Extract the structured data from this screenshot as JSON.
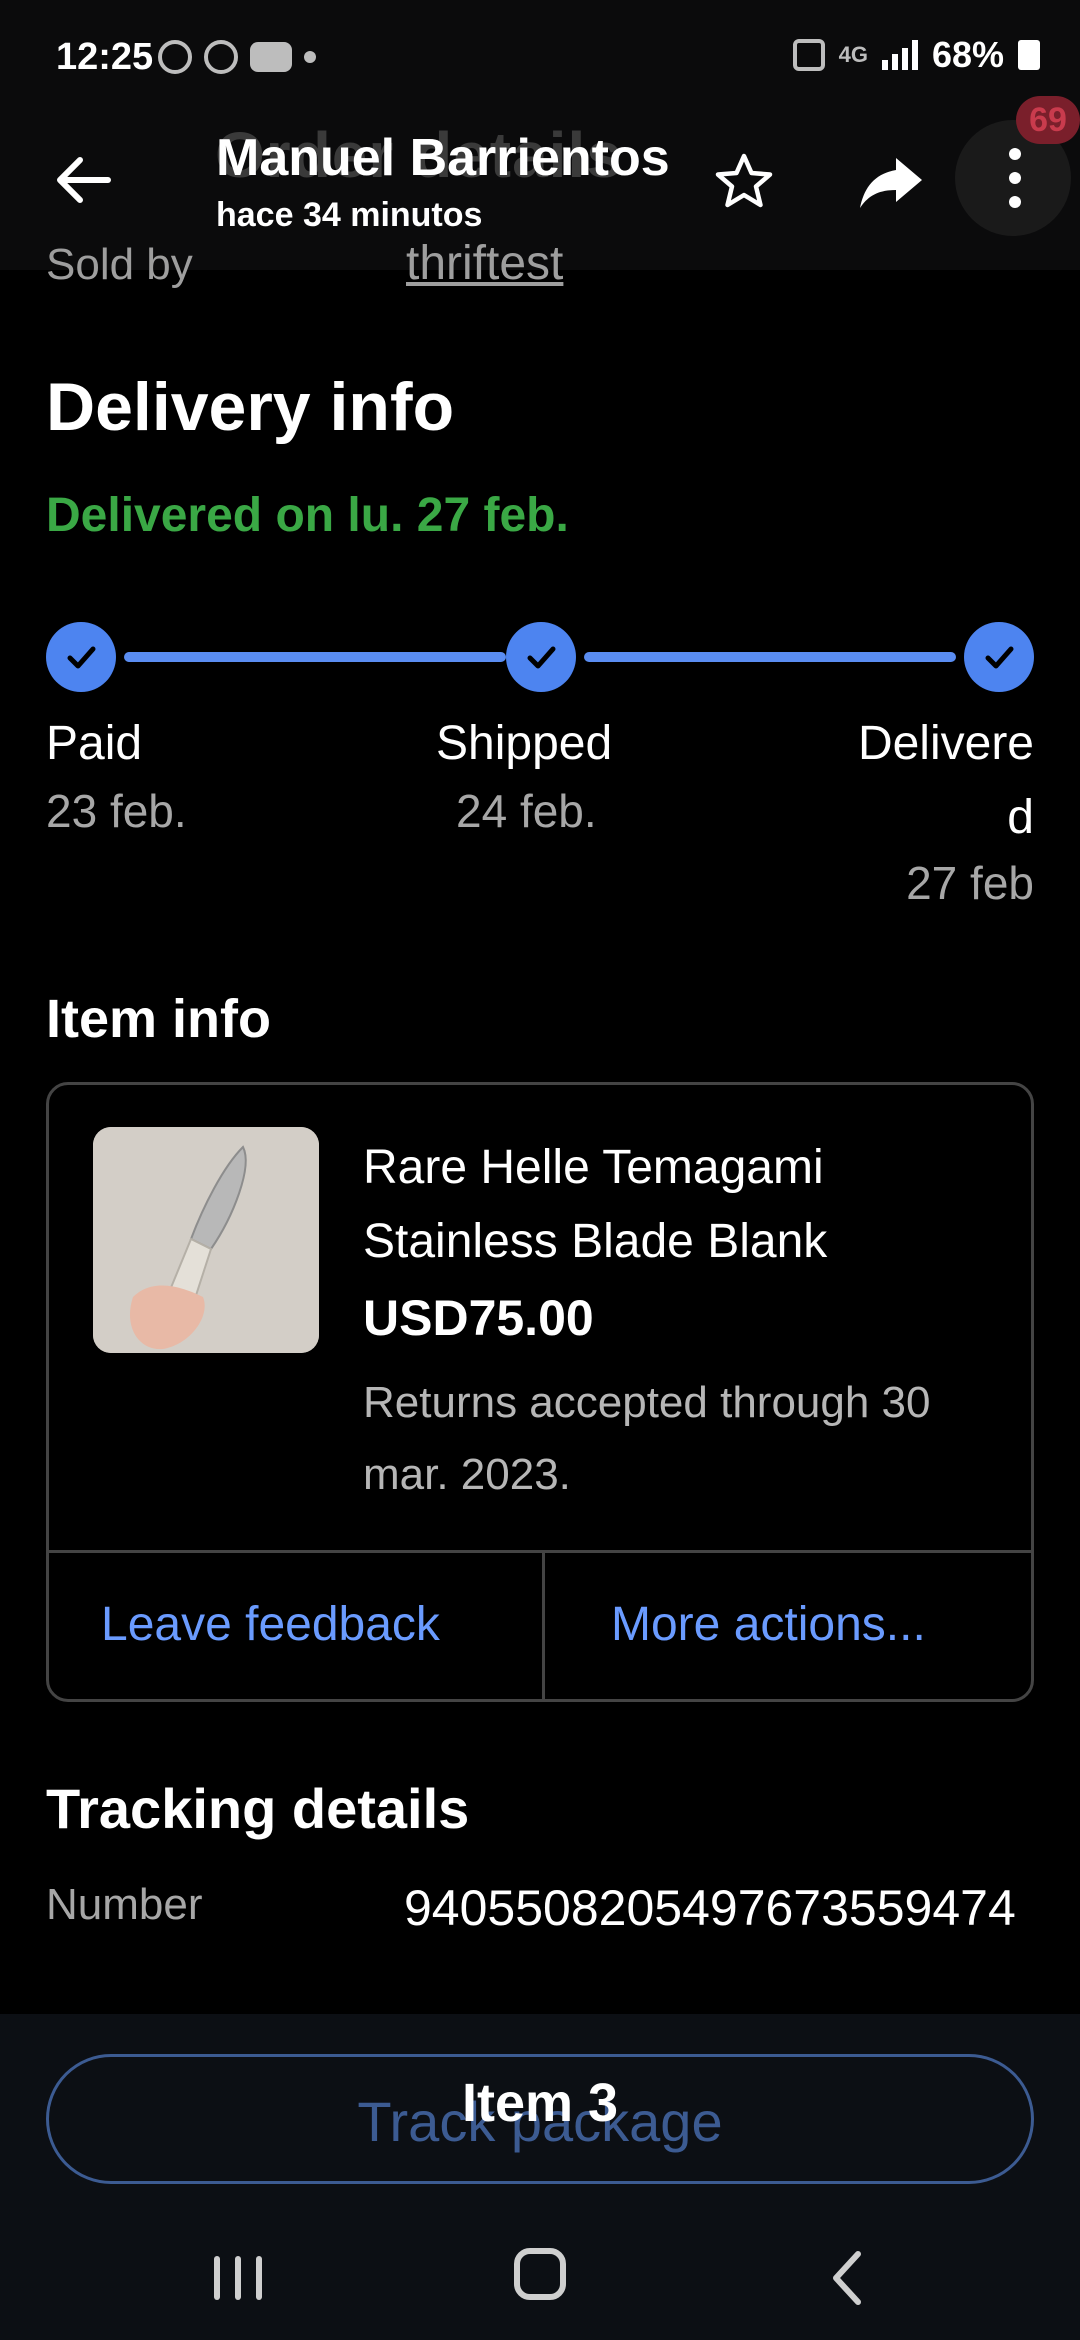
{
  "status_bar": {
    "time": "12:25",
    "battery": "68%",
    "network": "4G"
  },
  "header": {
    "ghost_title": "Order details",
    "title": "Manuel Barrientos",
    "subtitle": "hace 34 minutos",
    "cart_badge": "69"
  },
  "sold_by": {
    "label": "Sold by",
    "value": "thriftest"
  },
  "delivery": {
    "heading": "Delivery info",
    "status": "Delivered on lu. 27 feb.",
    "steps": [
      {
        "label": "Paid",
        "date": "23 feb."
      },
      {
        "label": "Shipped",
        "date": "24 feb."
      },
      {
        "label_line1": "Delivere",
        "label_line2": "d",
        "date": "27 feb"
      }
    ],
    "accent_color": "#4d84f0",
    "status_color": "#3aa845"
  },
  "item_info": {
    "heading": "Item info",
    "title": "Rare Helle Temagami Stainless Blade Blank",
    "price": "USD75.00",
    "returns": " Returns accepted through 30 mar. 2023.",
    "actions": {
      "leave_feedback": "Leave feedback",
      "more_actions": "More actions..."
    }
  },
  "tracking": {
    "heading": "Tracking details",
    "number_label": "Number",
    "number_value": "940550820549767355947​4"
  },
  "bottom": {
    "track_button": "Track package",
    "overlay_label": "Item 3"
  }
}
